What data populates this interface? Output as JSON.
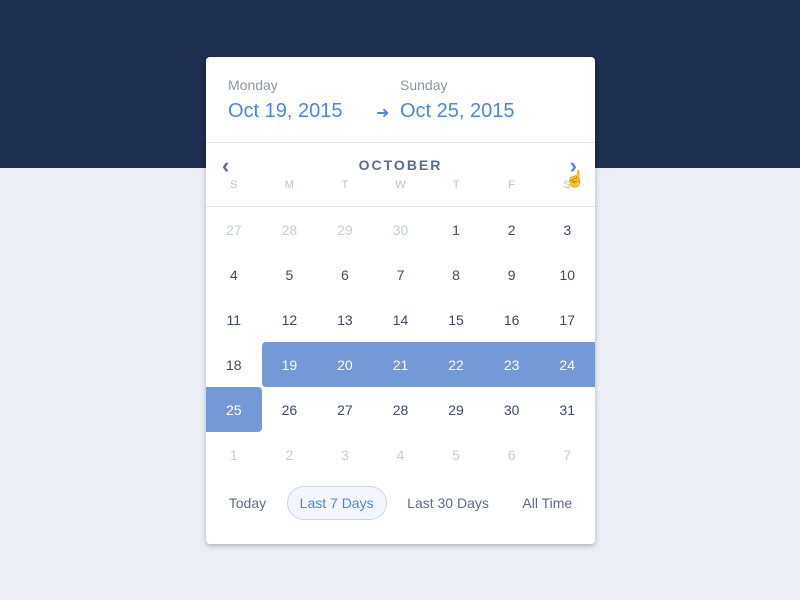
{
  "range": {
    "start_day": "Monday",
    "start_date": "Oct 19, 2015",
    "end_day": "Sunday",
    "end_date": "Oct 25, 2015"
  },
  "calendar": {
    "month": "OCTOBER",
    "weekdays": [
      "S",
      "M",
      "T",
      "W",
      "T",
      "F",
      "S"
    ],
    "days": [
      {
        "n": "27",
        "s": "muted"
      },
      {
        "n": "28",
        "s": "muted"
      },
      {
        "n": "29",
        "s": "muted"
      },
      {
        "n": "30",
        "s": "muted"
      },
      {
        "n": "1",
        "s": "normal"
      },
      {
        "n": "2",
        "s": "normal"
      },
      {
        "n": "3",
        "s": "normal"
      },
      {
        "n": "4",
        "s": "normal"
      },
      {
        "n": "5",
        "s": "normal"
      },
      {
        "n": "6",
        "s": "normal"
      },
      {
        "n": "7",
        "s": "normal"
      },
      {
        "n": "8",
        "s": "normal"
      },
      {
        "n": "9",
        "s": "normal"
      },
      {
        "n": "10",
        "s": "normal"
      },
      {
        "n": "11",
        "s": "normal"
      },
      {
        "n": "12",
        "s": "normal"
      },
      {
        "n": "13",
        "s": "normal"
      },
      {
        "n": "14",
        "s": "normal"
      },
      {
        "n": "15",
        "s": "normal"
      },
      {
        "n": "16",
        "s": "normal"
      },
      {
        "n": "17",
        "s": "normal"
      },
      {
        "n": "18",
        "s": "normal"
      },
      {
        "n": "19",
        "s": "selected"
      },
      {
        "n": "20",
        "s": "selected"
      },
      {
        "n": "21",
        "s": "selected"
      },
      {
        "n": "22",
        "s": "selected"
      },
      {
        "n": "23",
        "s": "selected"
      },
      {
        "n": "24",
        "s": "selected"
      },
      {
        "n": "25",
        "s": "selected"
      },
      {
        "n": "26",
        "s": "normal"
      },
      {
        "n": "27",
        "s": "normal"
      },
      {
        "n": "28",
        "s": "normal"
      },
      {
        "n": "29",
        "s": "normal"
      },
      {
        "n": "30",
        "s": "normal"
      },
      {
        "n": "31",
        "s": "normal"
      },
      {
        "n": "1",
        "s": "muted"
      },
      {
        "n": "2",
        "s": "muted"
      },
      {
        "n": "3",
        "s": "muted"
      },
      {
        "n": "4",
        "s": "muted"
      },
      {
        "n": "5",
        "s": "muted"
      },
      {
        "n": "6",
        "s": "muted"
      },
      {
        "n": "7",
        "s": "muted"
      }
    ]
  },
  "presets": [
    {
      "label": "Today",
      "active": false
    },
    {
      "label": "Last 7 Days",
      "active": true
    },
    {
      "label": "Last 30 Days",
      "active": false
    },
    {
      "label": "All Time",
      "active": false
    }
  ],
  "colors": {
    "accent": "#4a86e8",
    "selection": "#7399d6",
    "header_band": "#1e2e4f",
    "background": "#ebeef5"
  },
  "icons": {
    "arrow": "arrow-right",
    "prev": "chevron-left",
    "next": "chevron-right",
    "cursor": "hand-pointer"
  }
}
